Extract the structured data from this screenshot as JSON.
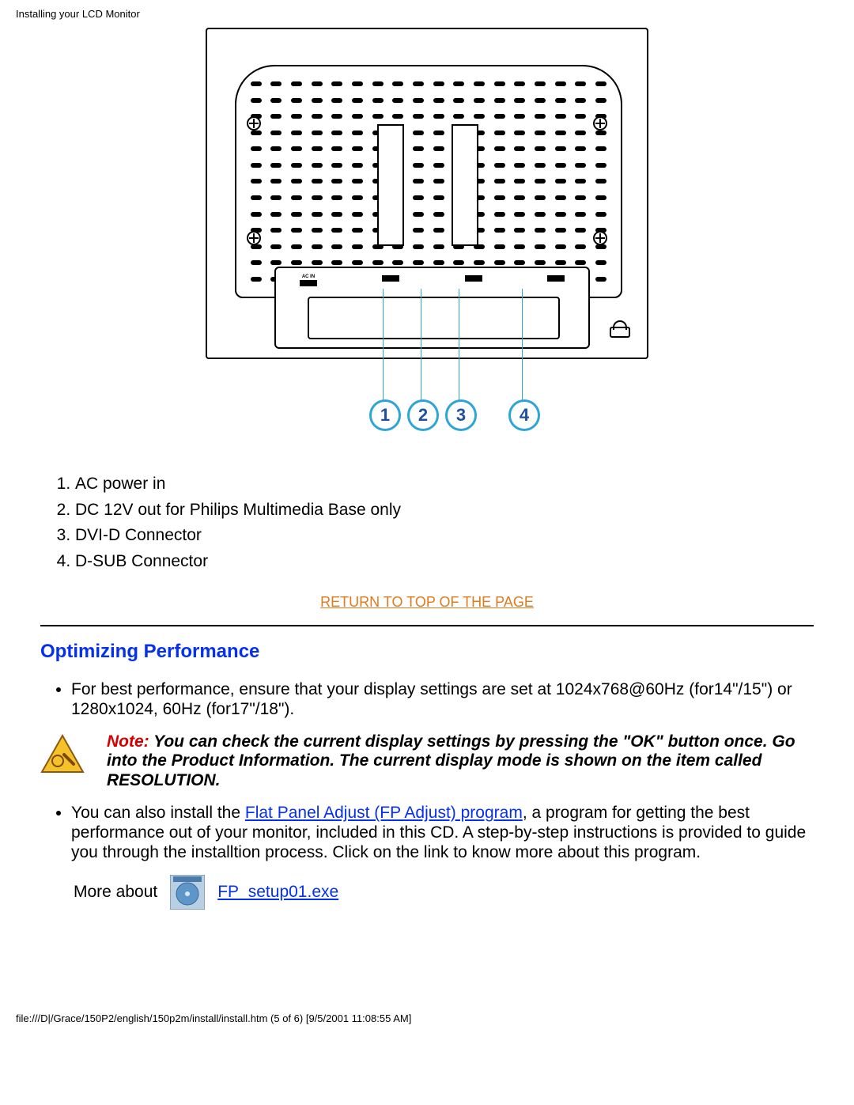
{
  "header": "Installing your LCD Monitor",
  "diagram": {
    "label_ac": "AC IN",
    "callouts": [
      "1",
      "2",
      "3",
      "4"
    ]
  },
  "connectors": [
    "AC power in",
    "DC 12V out for Philips Multimedia Base only",
    "DVI-D Connector",
    "D-SUB Connector"
  ],
  "return_top": "RETURN TO TOP OF THE PAGE",
  "section": "Optimizing Performance",
  "perf": {
    "item1": "For best performance, ensure that your display settings are set at 1024x768@60Hz (for14\"/15\") or 1280x1024, 60Hz (for17\"/18\").",
    "note_label": "Note:",
    "note_body": " You can check the current display settings by pressing the \"OK\" button once. Go into the Product Information. The current display mode is shown on the item called RESOLUTION.",
    "item2_a": "You can also install the ",
    "item2_link": "Flat Panel Adjust (FP Adjust) program",
    "item2_b": ", a program for getting the best performance out of your monitor, included in this CD. A step-by-step instructions is provided to guide you through the installtion process. Click on the link to know more about this program.",
    "more_label": "More about",
    "more_link": "FP_setup01.exe"
  },
  "footer": "file:///D|/Grace/150P2/english/150p2m/install/install.htm (5 of 6) [9/5/2001 11:08:55 AM]"
}
